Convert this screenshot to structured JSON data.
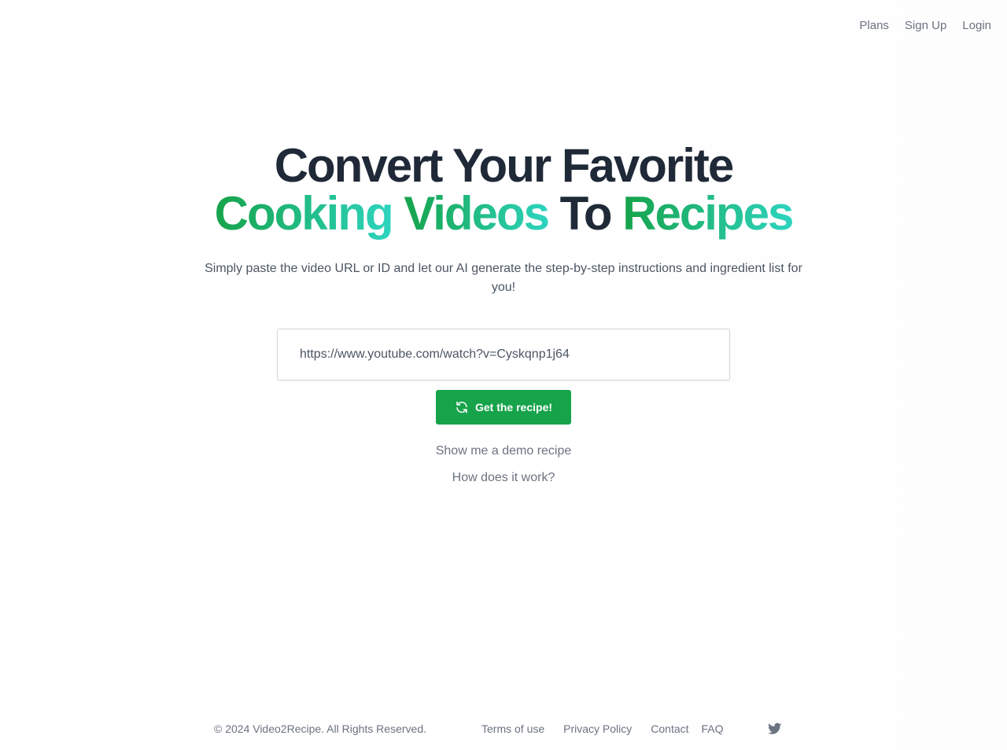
{
  "nav": {
    "plans": "Plans",
    "signup": "Sign Up",
    "login": "Login"
  },
  "hero": {
    "line1": "Convert Your Favorite",
    "word_cooking": "Cooking",
    "word_videos": "Videos",
    "word_to": "To",
    "word_recipes": "Recipes",
    "subtitle": "Simply paste the video URL or ID and let our AI generate the step-by-step instructions and ingredient list for you!"
  },
  "search": {
    "value": "https://www.youtube.com/watch?v=Cyskqnp1j64"
  },
  "cta": {
    "label": "Get the recipe!",
    "icon": "refresh-icon"
  },
  "links": {
    "demo": "Show me a demo recipe",
    "how": "How does it work?"
  },
  "footer": {
    "copyright": "© 2024 Video2Recipe. All Rights Reserved.",
    "terms": "Terms of use",
    "privacy": "Privacy Policy",
    "contact": "Contact",
    "faq": "FAQ",
    "social_icon": "twitter-icon"
  },
  "colors": {
    "accent": "#16a34a",
    "gradient_end": "#2dd4bf",
    "heading": "#1f2937",
    "muted": "#6b7280"
  }
}
